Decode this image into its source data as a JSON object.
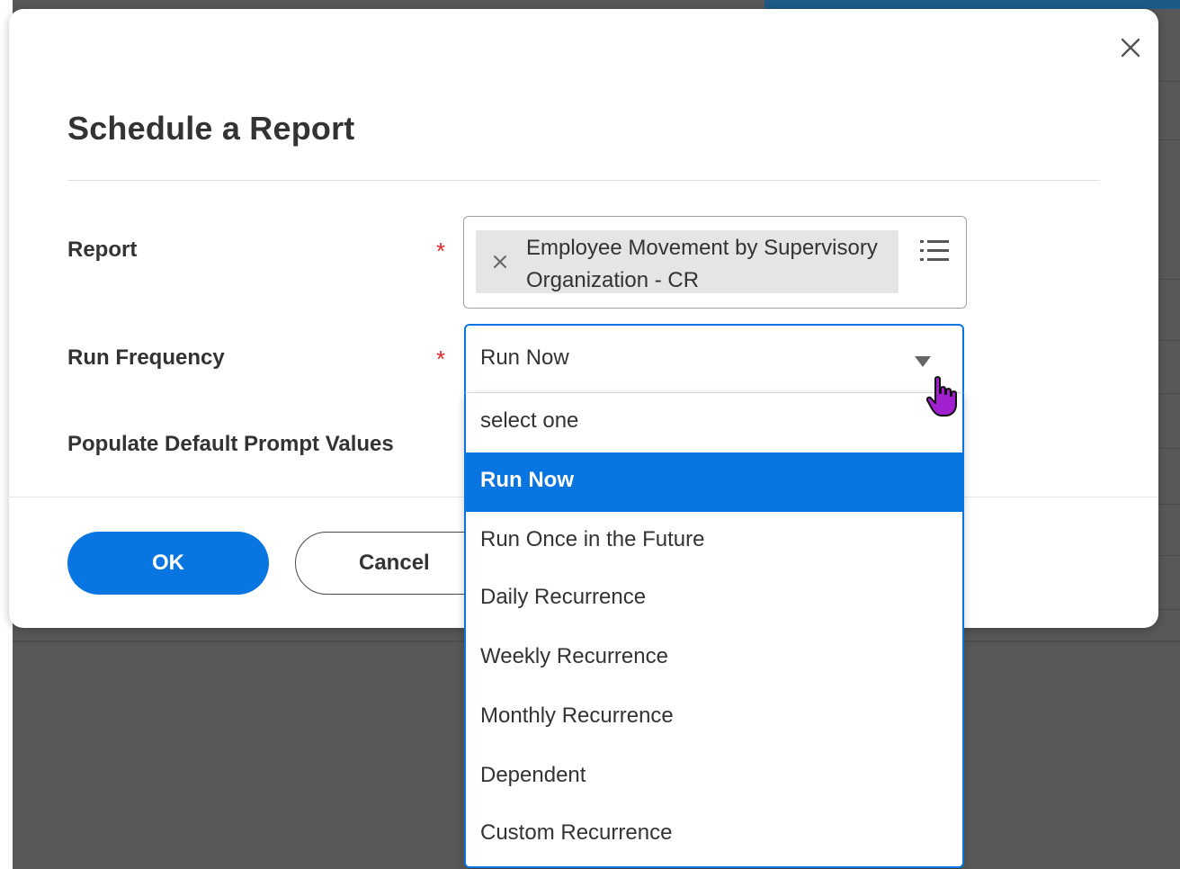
{
  "dialog": {
    "title": "Schedule a Report",
    "close_icon": "close-icon"
  },
  "fields": {
    "report": {
      "label": "Report",
      "required": true,
      "selected_value": "Employee Movement by Supervisory Organization - CR",
      "remove_icon": "close-icon",
      "list_icon": "list-icon"
    },
    "run_frequency": {
      "label": "Run Frequency",
      "required": true,
      "value": "Run Now",
      "caret_icon": "caret-down-icon",
      "options": [
        "select one",
        "Run Now",
        "Run Once in the Future",
        "Daily Recurrence",
        "Weekly Recurrence",
        "Monthly Recurrence",
        "Dependent",
        "Custom Recurrence"
      ],
      "selected_option": "Run Now"
    },
    "populate_defaults": {
      "label": "Populate Default Prompt Values"
    }
  },
  "footer": {
    "ok_label": "OK",
    "cancel_label": "Cancel"
  },
  "required_marker": "*",
  "colors": {
    "primary": "#0875e1",
    "required": "#de2727",
    "overlay": "#585858",
    "cursor": "#a020d0"
  }
}
